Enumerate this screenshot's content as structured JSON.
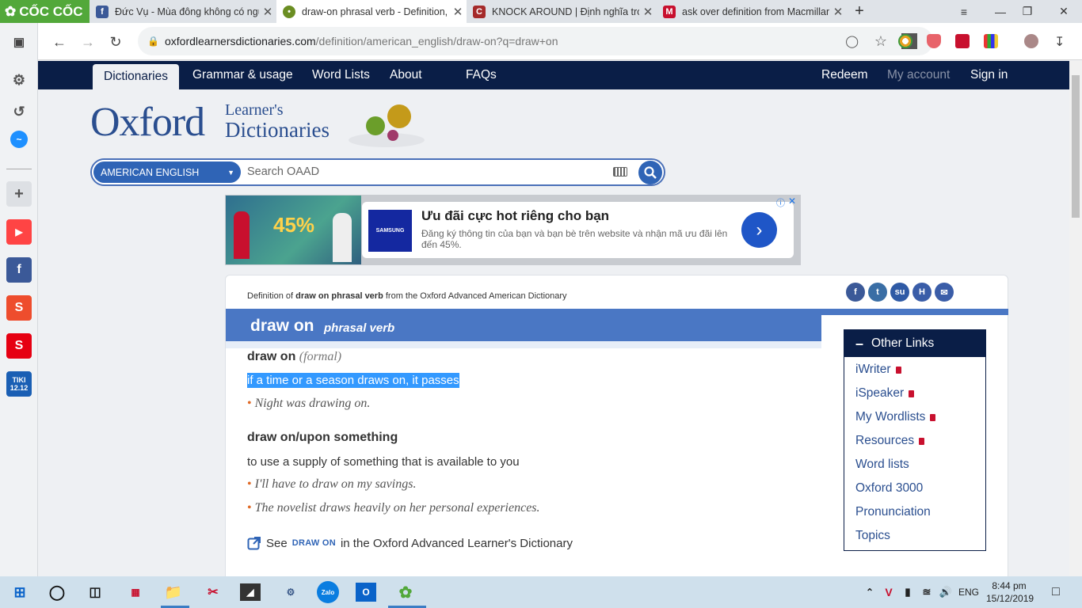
{
  "browser": {
    "brand": "CỐC CỐC",
    "tabs": [
      {
        "title": "Đức Vụ - Mùa đông không có ngư"
      },
      {
        "title": "draw-on phrasal verb - Definition,"
      },
      {
        "title": "KNOCK AROUND | Định nghĩa tron"
      },
      {
        "title": "ask over definition from Macmillan"
      }
    ],
    "url_host": "oxfordlearnersdictionaries.com",
    "url_path": "/definition/american_english/draw-on?q=draw+on"
  },
  "site_nav": {
    "items": [
      "Dictionaries",
      "Grammar & usage",
      "Word Lists",
      "About",
      "FAQs"
    ],
    "right": [
      "Redeem",
      "My account",
      "Sign in"
    ]
  },
  "logo": {
    "main": "Oxford",
    "line1": "Learner's",
    "line2": "Dictionaries"
  },
  "search": {
    "language": "AMERICAN ENGLISH",
    "placeholder": "Search OAAD"
  },
  "ad": {
    "left_badge": "45%",
    "logo": "SAMSUNG",
    "title": "Ưu đãi cực hot riêng cho bạn",
    "text": "Đăng ký thông tin của bạn và bạn bè trên website và nhận mã ưu đãi lên đến 45%."
  },
  "entry": {
    "crumb_pre": "Definition of ",
    "crumb_bold": "draw on phrasal verb",
    "crumb_post": " from the Oxford Advanced American Dictionary",
    "headword": "draw on",
    "pos": "phrasal verb",
    "sense1": {
      "label": "draw on",
      "register": "(formal)",
      "definition": "if a time or a season draws on, it passes",
      "examples": [
        "Night was drawing on."
      ]
    },
    "sense2": {
      "label": "draw on/upon something",
      "definition": "to use a supply of something that is available to you",
      "examples": [
        "I'll have to draw on my savings.",
        "The novelist draws heavily on her personal experiences."
      ]
    },
    "see_pre": "See",
    "see_link": "DRAW ON",
    "see_post": "in the Oxford Advanced Learner's Dictionary"
  },
  "other_links": {
    "title": "Other Links",
    "items": [
      "iWriter",
      "iSpeaker",
      "My Wordlists",
      "Resources",
      "Word lists",
      "Oxford 3000",
      "Pronunciation",
      "Topics"
    ]
  },
  "taskbar": {
    "lang": "ENG",
    "time": "8:44 pm",
    "date": "15/12/2019"
  }
}
